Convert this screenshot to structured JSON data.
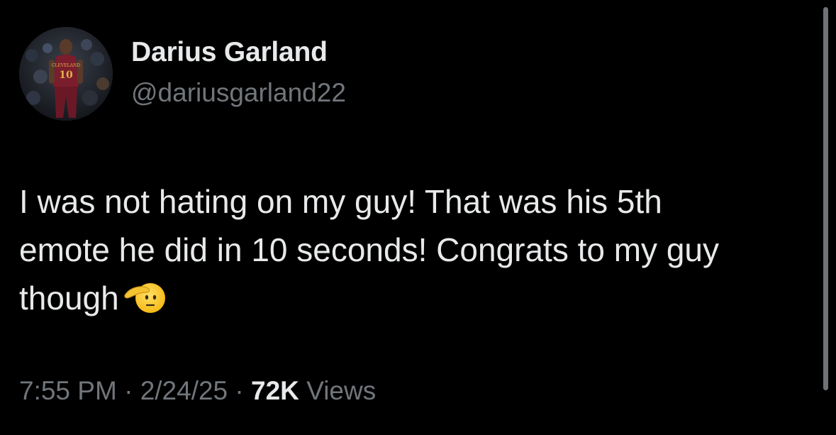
{
  "author": {
    "display_name": "Darius Garland",
    "handle": "@dariusgarland22",
    "avatar_icon": "player-profile-photo",
    "jersey_text": "CLEVELAND",
    "jersey_number": "10"
  },
  "tweet": {
    "lines": [
      "I was not hating on my guy! That was his 5th",
      "emote he did in 10 seconds! Congrats to my guy",
      "though"
    ],
    "emoji_icon": "saluting-face-emoji"
  },
  "meta": {
    "time": "7:55 PM",
    "separator": "·",
    "date": "2/24/25",
    "views_count": "72K",
    "views_label": "Views"
  },
  "colors": {
    "background": "#000000",
    "primary_text": "#e7e9ea",
    "secondary_text": "#71767b"
  }
}
